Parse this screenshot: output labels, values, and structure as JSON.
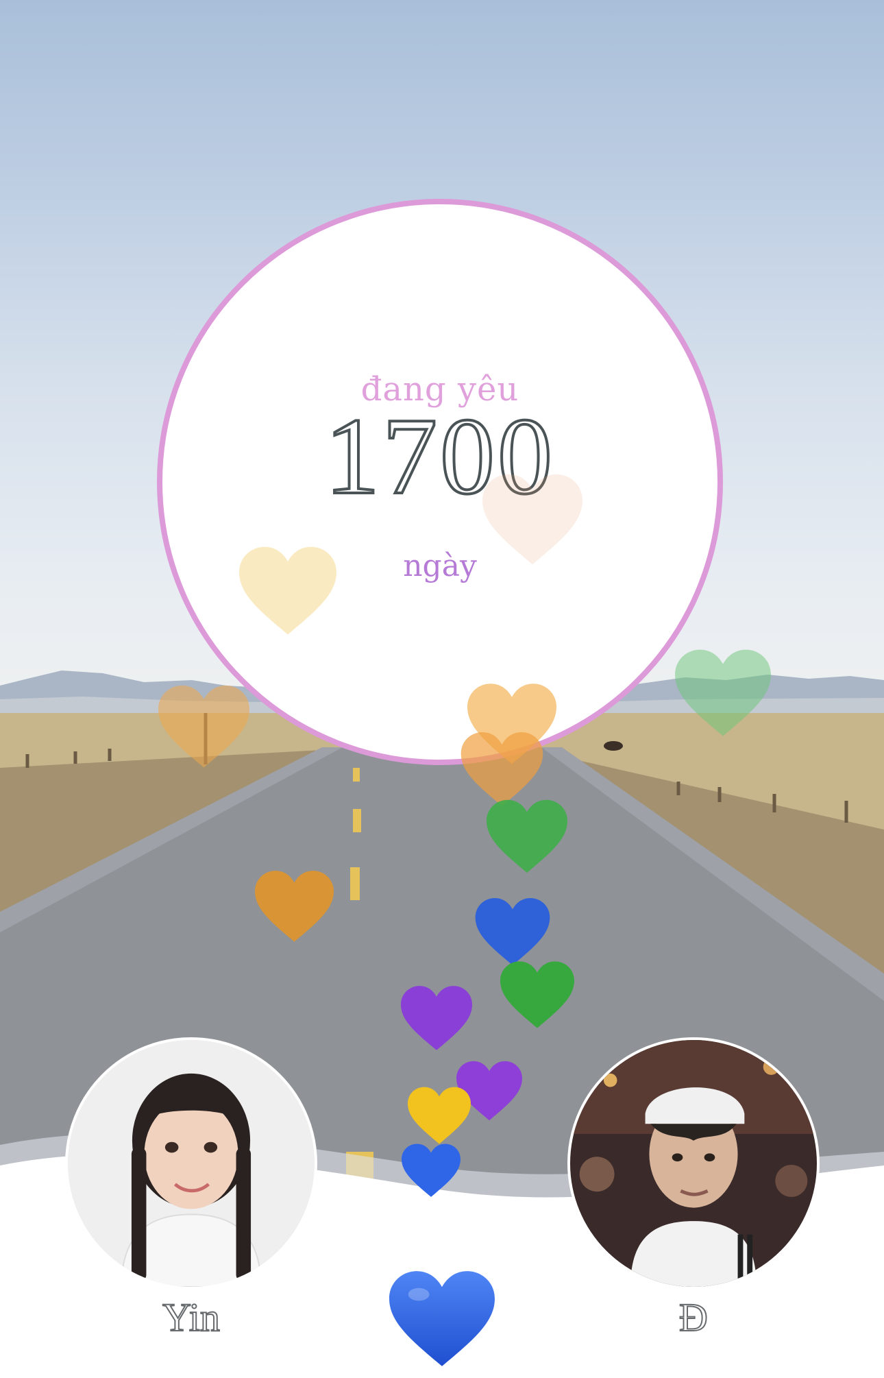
{
  "counter": {
    "label_top": "đang yêu",
    "days": "1700",
    "label_bottom": "ngày"
  },
  "people": {
    "left_name": "Yin",
    "right_name": "Đ"
  },
  "colors": {
    "ring": "#dd9ad9",
    "label_top": "#e0a0dc",
    "label_bottom": "#b47ad6",
    "big_heart": "#2f66e8"
  },
  "icons": {
    "floating": "heart-emoji",
    "button": "blue-heart-icon"
  }
}
